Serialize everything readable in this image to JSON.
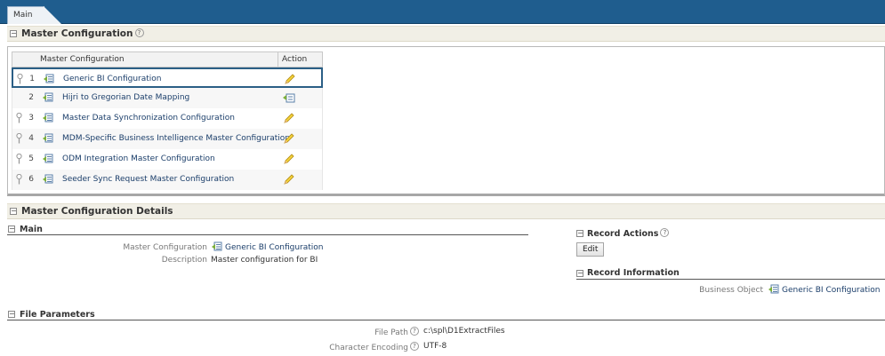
{
  "tabs": [
    {
      "label": "Main"
    }
  ],
  "master_section": {
    "title": "Master Configuration"
  },
  "grid": {
    "columns": [
      "Master Configuration",
      "Action"
    ],
    "rows": [
      {
        "num": "1",
        "label": "Generic BI Configuration",
        "action": "edit",
        "pinned": true
      },
      {
        "num": "2",
        "label": "Hijri to Gregorian Date Mapping",
        "action": "add",
        "pinned": false
      },
      {
        "num": "3",
        "label": "Master Data Synchronization Configuration",
        "action": "edit",
        "pinned": true
      },
      {
        "num": "4",
        "label": "MDM-Specific Business Intelligence Master Configuration",
        "action": "edit",
        "pinned": true
      },
      {
        "num": "5",
        "label": "ODM Integration Master Configuration",
        "action": "edit",
        "pinned": true
      },
      {
        "num": "6",
        "label": "Seeder Sync Request Master Configuration",
        "action": "edit",
        "pinned": true
      }
    ]
  },
  "details_section": {
    "title": "Master Configuration Details"
  },
  "main_group": {
    "title": "Main",
    "master_config_label": "Master Configuration",
    "master_config_value": "Generic BI Configuration",
    "description_label": "Description",
    "description_value": "Master configuration for BI"
  },
  "record_actions": {
    "title": "Record Actions",
    "edit_label": "Edit"
  },
  "record_information": {
    "title": "Record Information",
    "business_object_label": "Business Object",
    "business_object_value": "Generic BI Configuration"
  },
  "file_parameters": {
    "title": "File Parameters",
    "file_path_label": "File Path",
    "file_path_value": "c:\\spl\\D1ExtractFiles",
    "encoding_label": "Character Encoding",
    "encoding_value": "UTF-8"
  },
  "colors": {
    "tabbar": "#1f5d8e",
    "selected_border": "#2b5f86",
    "link": "#1b3e6a"
  }
}
